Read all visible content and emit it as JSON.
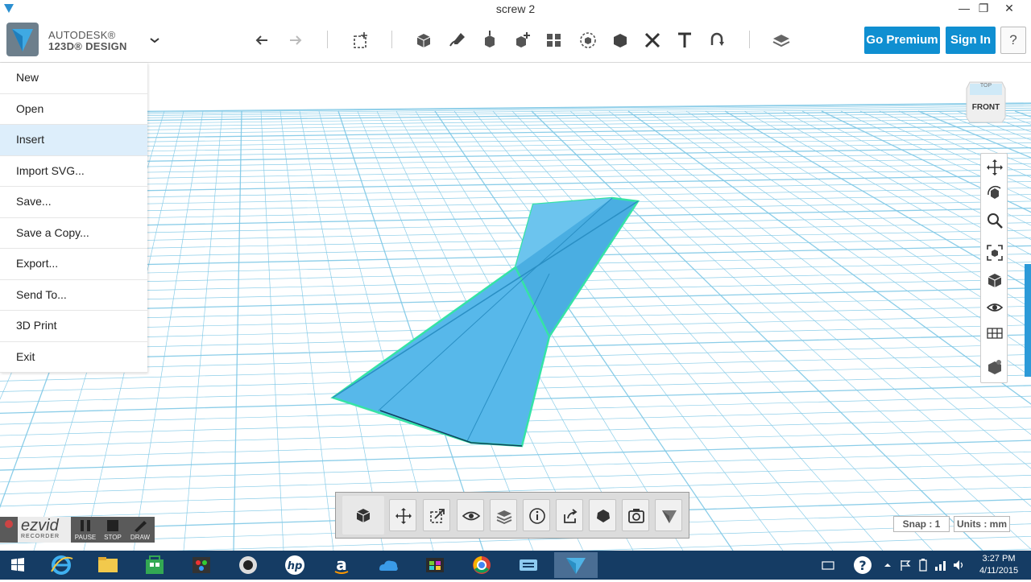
{
  "window": {
    "title": "screw 2"
  },
  "app": {
    "brand_line1": "AUTODESK®",
    "brand_line2": "123D® DESIGN"
  },
  "toolbar": {
    "premium_label": "Go Premium",
    "signin_label": "Sign In",
    "help_label": "?"
  },
  "file_menu": {
    "items": [
      {
        "label": "New"
      },
      {
        "label": "Open"
      },
      {
        "label": "Insert"
      },
      {
        "label": "Import SVG..."
      },
      {
        "label": "Save..."
      },
      {
        "label": "Save a Copy..."
      },
      {
        "label": "Export..."
      },
      {
        "label": "Send To..."
      },
      {
        "label": "3D Print"
      },
      {
        "label": "Exit"
      }
    ],
    "hovered_index": 2
  },
  "viewcube": {
    "top_label": "TOP",
    "front_label": "FRONT"
  },
  "status": {
    "snap": "Snap : 1",
    "units": "Units : mm"
  },
  "ezvid": {
    "brand": "ezvid",
    "sub": "RECORDER",
    "pause": "PAUSE",
    "stop": "STOP",
    "draw": "DRAW"
  },
  "taskbar": {
    "time": "3:27 PM",
    "date": "4/11/2015"
  },
  "colors": {
    "accent": "#0f8fd1",
    "grid": "#7fc8e6",
    "model_fill": "#4fb3e6",
    "model_outline": "#2fe0a0",
    "taskbar": "#153c64"
  }
}
